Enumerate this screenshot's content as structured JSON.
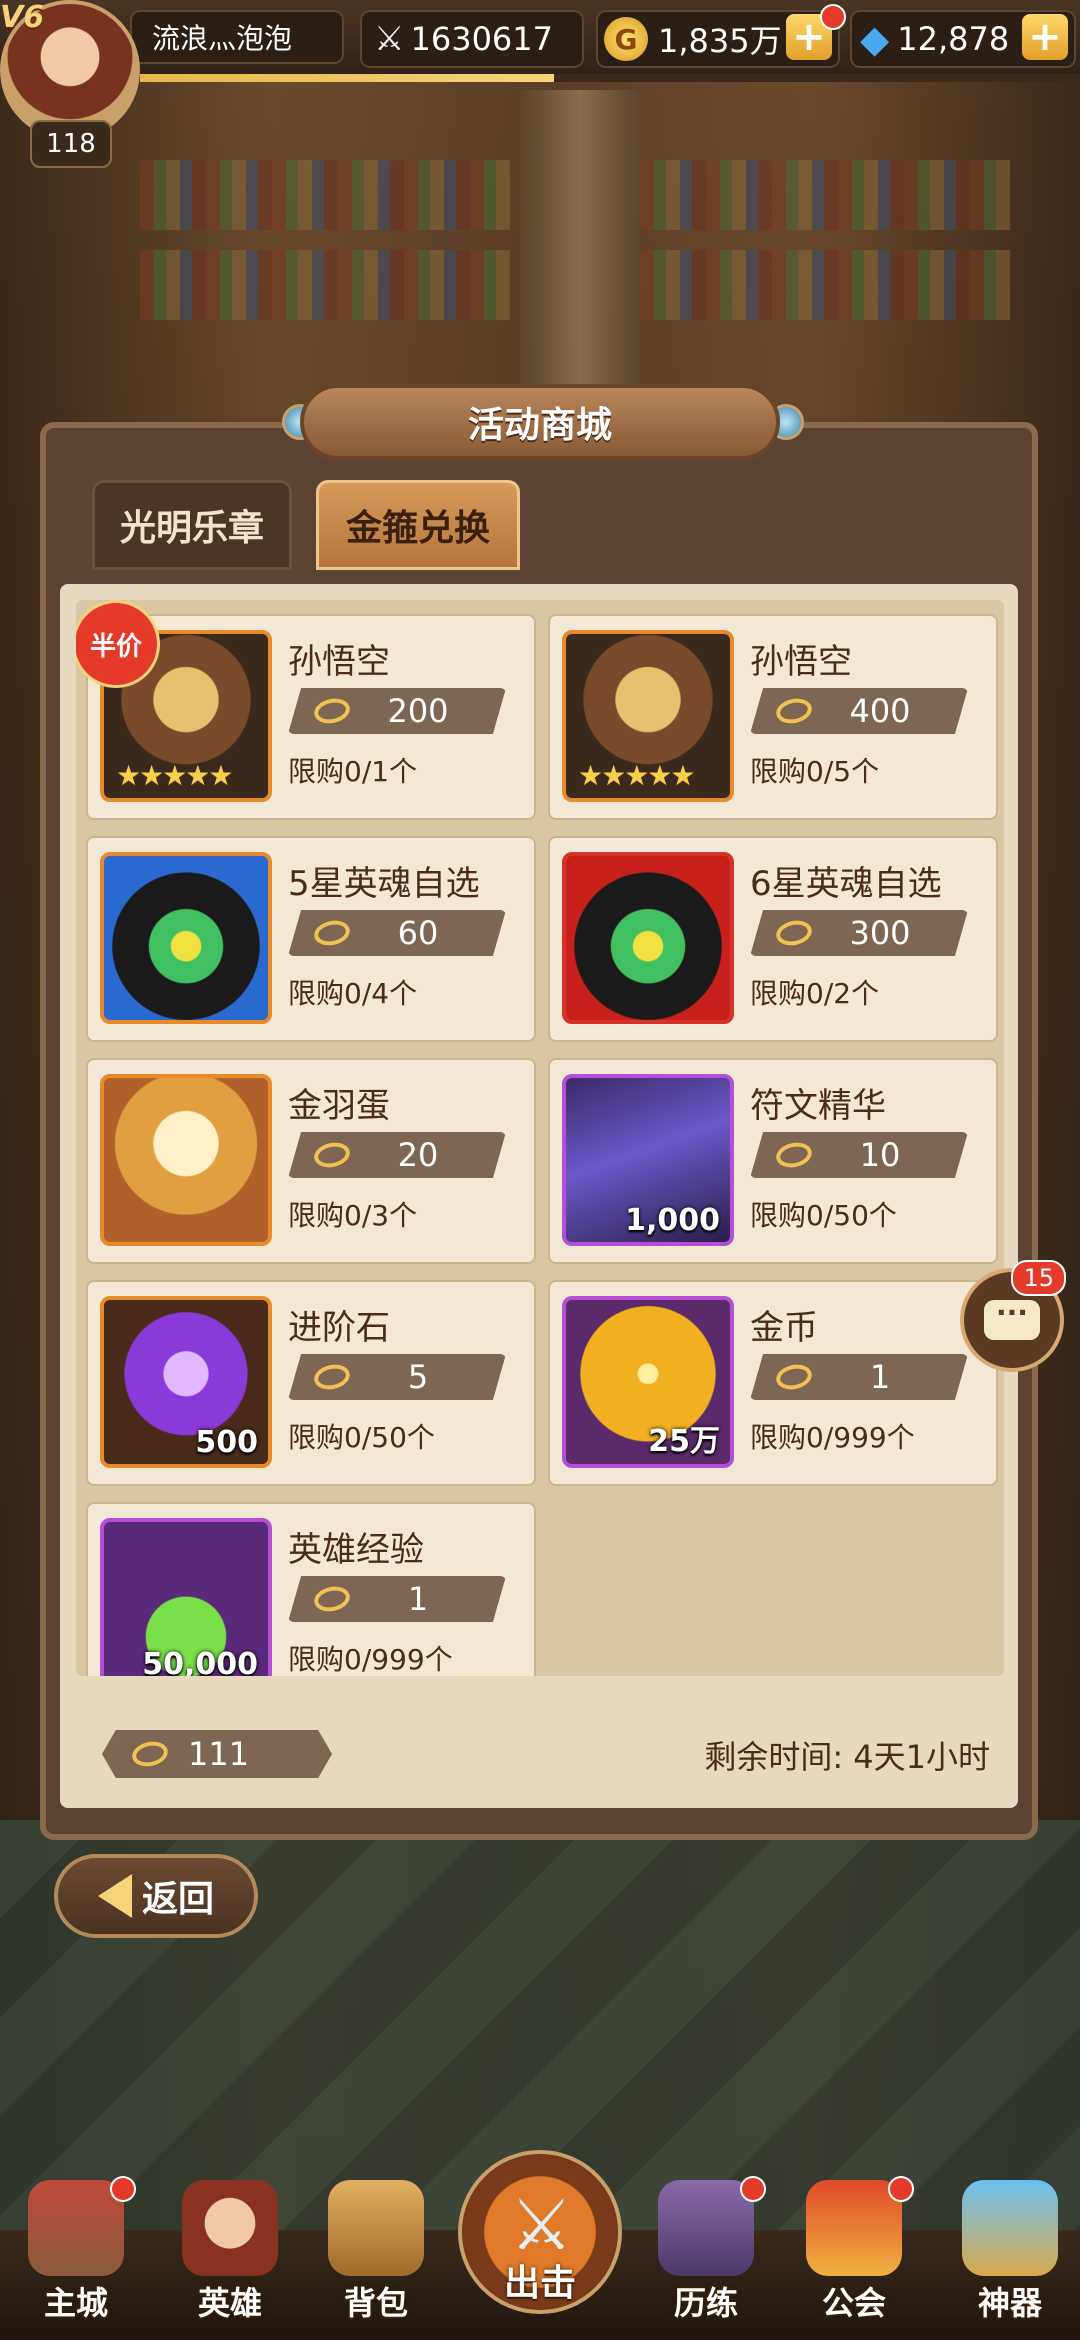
{
  "player": {
    "vip": "V6",
    "name": "流浪灬泡泡",
    "level": "118",
    "power": "1630617",
    "gold": "1,835万",
    "diamonds": "12,878",
    "xp_progress": 0.44
  },
  "shop": {
    "title": "活动商城",
    "tabs": [
      {
        "label": "光明乐章",
        "active": false
      },
      {
        "label": "金箍兑换",
        "active": true
      }
    ],
    "half_price_badge": "半价",
    "items": [
      {
        "name": "孙悟空",
        "price": "200",
        "limit": "限购0/1个",
        "qty": "",
        "icon": "sun-wukong-portrait-icon",
        "stars": "★★★★★",
        "half": true
      },
      {
        "name": "孙悟空",
        "price": "400",
        "limit": "限购0/5个",
        "qty": "",
        "icon": "sun-wukong-portrait-icon",
        "stars": "★★★★★",
        "half": false
      },
      {
        "name": "5星英魂自选",
        "price": "60",
        "limit": "限购0/4个",
        "qty": "",
        "icon": "hero-soul-helmet-icon",
        "stars": "",
        "half": false
      },
      {
        "name": "6星英魂自选",
        "price": "300",
        "limit": "限购0/2个",
        "qty": "",
        "icon": "hero-soul-helmet-red-icon",
        "stars": "",
        "half": false
      },
      {
        "name": "金羽蛋",
        "price": "20",
        "limit": "限购0/3个",
        "qty": "",
        "icon": "golden-feather-egg-icon",
        "stars": "",
        "half": false
      },
      {
        "name": "符文精华",
        "price": "10",
        "limit": "限购0/50个",
        "qty": "1,000",
        "icon": "rune-crystal-icon",
        "stars": "",
        "half": false
      },
      {
        "name": "进阶石",
        "price": "5",
        "limit": "限购0/50个",
        "qty": "500",
        "icon": "advancement-stone-icon",
        "stars": "",
        "half": false
      },
      {
        "name": "金币",
        "price": "1",
        "limit": "限购0/999个",
        "qty": "25万",
        "icon": "gold-coin-icon",
        "stars": "",
        "half": false
      },
      {
        "name": "英雄经验",
        "price": "1",
        "limit": "限购0/999个",
        "qty": "50,000",
        "icon": "hero-exp-potion-icon",
        "stars": "",
        "half": false
      }
    ],
    "owned_currency": "111",
    "remaining_time": "剩余时间: 4天1小时",
    "back_label": "返回"
  },
  "chat": {
    "unread": "15",
    "icon": "chat-bubble-icon"
  },
  "nav": [
    {
      "label": "主城",
      "icon": "castle-icon",
      "badge": true
    },
    {
      "label": "英雄",
      "icon": "hero-face-icon",
      "badge": false
    },
    {
      "label": "背包",
      "icon": "backpack-icon",
      "badge": false
    },
    {
      "label": "出击",
      "icon": "crossed-swords-icon",
      "badge": false
    },
    {
      "label": "历练",
      "icon": "treasure-chest-icon",
      "badge": true
    },
    {
      "label": "公会",
      "icon": "guild-shield-icon",
      "badge": true
    },
    {
      "label": "神器",
      "icon": "artifact-crystal-icon",
      "badge": false
    }
  ],
  "colors": {
    "panel_bg": "#5a4332",
    "card_bg": "#f3e8d5",
    "orange_border": "#e8892a",
    "purple_border": "#b44fd6",
    "red_border": "#d8302a",
    "badge_red": "#e33a2a"
  }
}
